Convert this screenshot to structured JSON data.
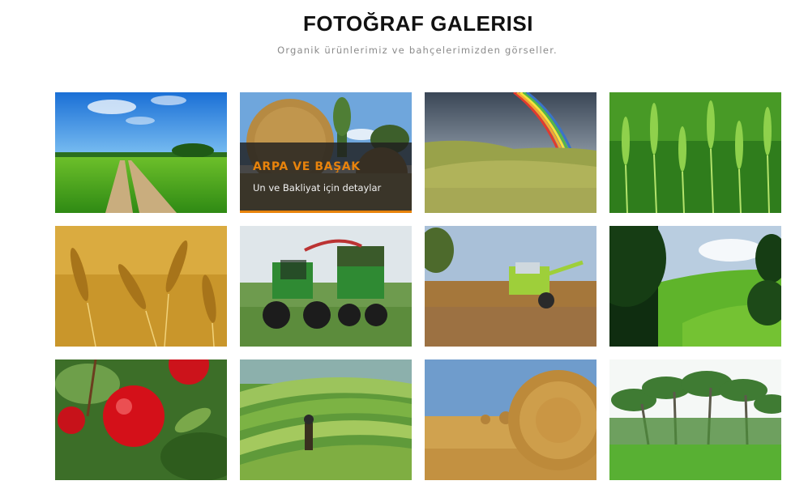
{
  "header": {
    "title": "FOTOĞRAF GALERISI",
    "subtitle": "Organik ürünlerimiz ve bahçelerimizden görseller."
  },
  "gallery": {
    "hover_item": {
      "title": "ARPA VE BAŞAK",
      "subtitle": "Un ve Bakliyat için detaylar"
    },
    "accent_color": "#e8830c",
    "items": [
      {
        "icon": "country-road-photo"
      },
      {
        "icon": "hay-bale-field-photo"
      },
      {
        "icon": "rainbow-hills-photo"
      },
      {
        "icon": "green-wheat-photo"
      },
      {
        "icon": "golden-wheat-photo"
      },
      {
        "icon": "green-tractors-photo"
      },
      {
        "icon": "combine-harvester-photo"
      },
      {
        "icon": "forest-meadow-photo"
      },
      {
        "icon": "red-apples-photo"
      },
      {
        "icon": "rice-terraces-photo"
      },
      {
        "icon": "round-hay-bale-photo"
      },
      {
        "icon": "palm-trees-photo"
      }
    ]
  }
}
